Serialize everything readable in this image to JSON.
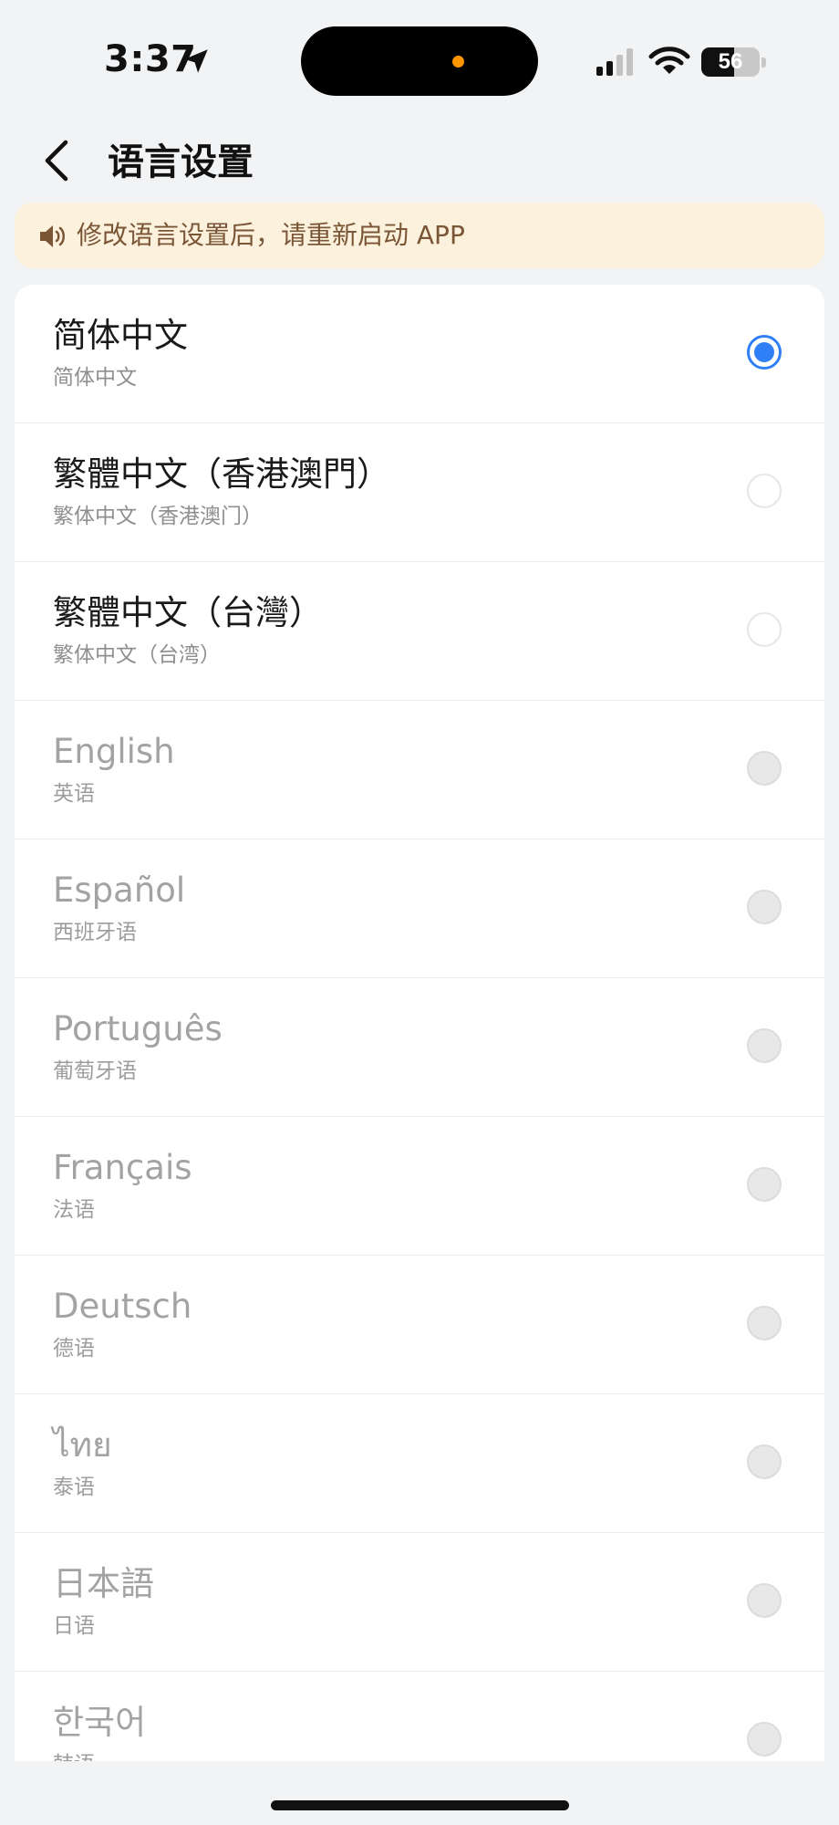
{
  "status_bar": {
    "time": "3:37",
    "battery_percent": 56,
    "battery_label": "56",
    "location_icon": "location-arrow-icon",
    "signal_icon": "cellular-signal-icon",
    "wifi_icon": "wifi-icon",
    "indicator_color": "#ff9500"
  },
  "header": {
    "title": "语言设置",
    "back_icon": "chevron-left-icon"
  },
  "notice": {
    "icon": "speaker-icon",
    "text": "修改语言设置后，请重新启动 APP",
    "background": "#fcf1dd",
    "text_color": "#7b5636"
  },
  "accent_color": "#2f7ff7",
  "languages": [
    {
      "name": "简体中文",
      "subtitle": "简体中文",
      "selected": true,
      "enabled": true
    },
    {
      "name": "繁體中文（香港澳門）",
      "subtitle": "繁体中文（香港澳门）",
      "selected": false,
      "enabled": true
    },
    {
      "name": "繁體中文（台灣）",
      "subtitle": "繁体中文（台湾）",
      "selected": false,
      "enabled": true
    },
    {
      "name": "English",
      "subtitle": "英语",
      "selected": false,
      "enabled": false
    },
    {
      "name": "Español",
      "subtitle": "西班牙语",
      "selected": false,
      "enabled": false
    },
    {
      "name": "Português",
      "subtitle": "葡萄牙语",
      "selected": false,
      "enabled": false
    },
    {
      "name": "Français",
      "subtitle": "法语",
      "selected": false,
      "enabled": false
    },
    {
      "name": "Deutsch",
      "subtitle": "德语",
      "selected": false,
      "enabled": false
    },
    {
      "name": "ไทย",
      "subtitle": "泰语",
      "selected": false,
      "enabled": false
    },
    {
      "name": "日本語",
      "subtitle": "日语",
      "selected": false,
      "enabled": false
    },
    {
      "name": "한국어",
      "subtitle": "韩语",
      "selected": false,
      "enabled": false
    }
  ]
}
